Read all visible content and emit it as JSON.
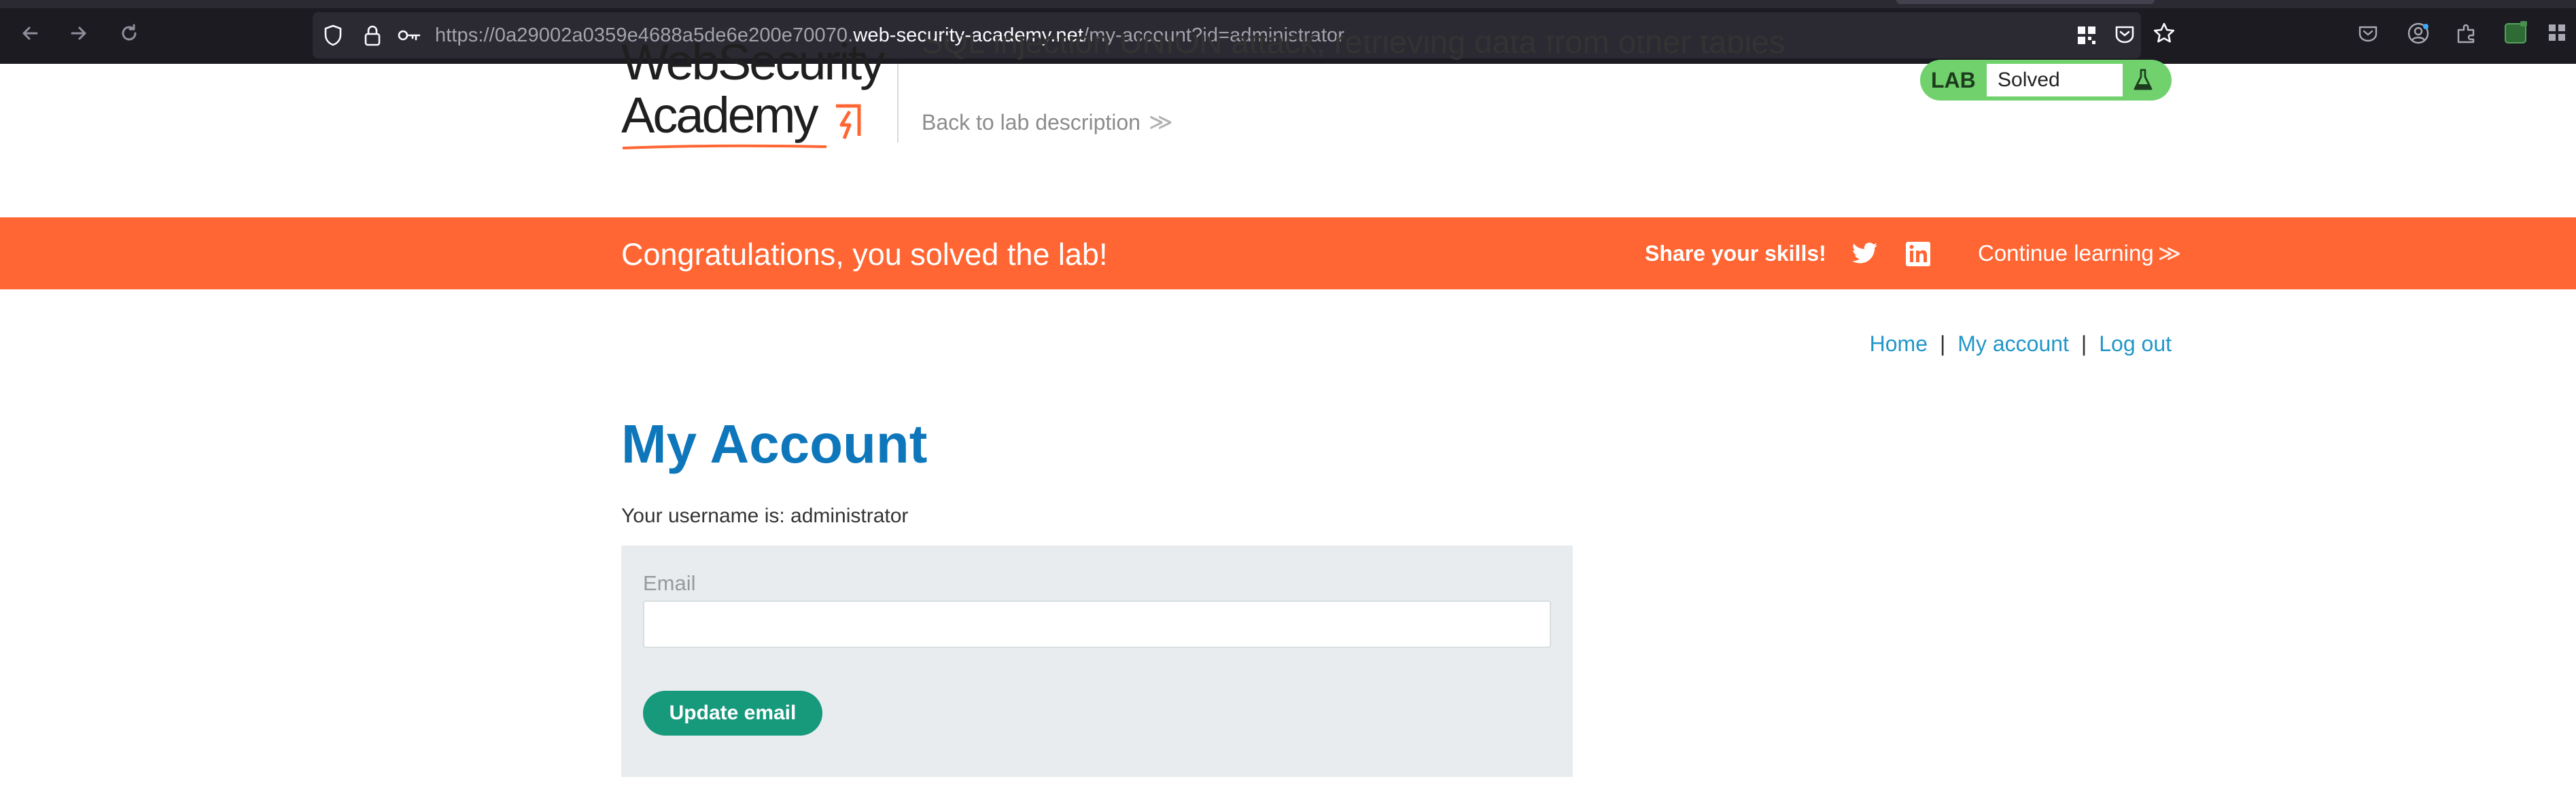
{
  "browser": {
    "url_prefix": "https://0a29002a0359e4688a5de6e200e70070.",
    "url_domain": "web-security-academy.net",
    "url_path": "/my-account?id=administrator"
  },
  "header": {
    "logo_line1": "WebSecurity",
    "logo_line2": "Academy",
    "lab_title": "SQL injection UNION attack, retrieving data from other tables",
    "back_link": "Back to lab description",
    "back_chevron": "≫",
    "lab_badge": {
      "label": "LAB",
      "status": "Solved"
    }
  },
  "banner": {
    "message": "Congratulations, you solved the lab!",
    "share_label": "Share your skills!",
    "continue_label": "Continue learning",
    "continue_chevron": "≫"
  },
  "nav": {
    "home": "Home",
    "my_account": "My account",
    "log_out": "Log out",
    "separator": "|"
  },
  "main": {
    "title": "My Account",
    "username_line": "Your username is: administrator",
    "email_label": "Email",
    "email_value": "",
    "update_button": "Update email"
  },
  "colors": {
    "banner": "#ff6633",
    "title_blue": "#0e76ba",
    "link_blue": "#2196c9",
    "button_green": "#17997c",
    "badge_green": "#70d16d"
  },
  "icons": [
    "back-icon",
    "forward-icon",
    "reload-icon",
    "shield-icon",
    "lock-icon",
    "permissions-key-icon",
    "qr-code-icon",
    "pocket-save-icon",
    "bookmark-star-icon",
    "pocket-icon",
    "account-icon",
    "extensions-icon",
    "burp-extension-icon",
    "overflow-icon",
    "flask-icon",
    "twitter-icon",
    "linkedin-icon"
  ]
}
